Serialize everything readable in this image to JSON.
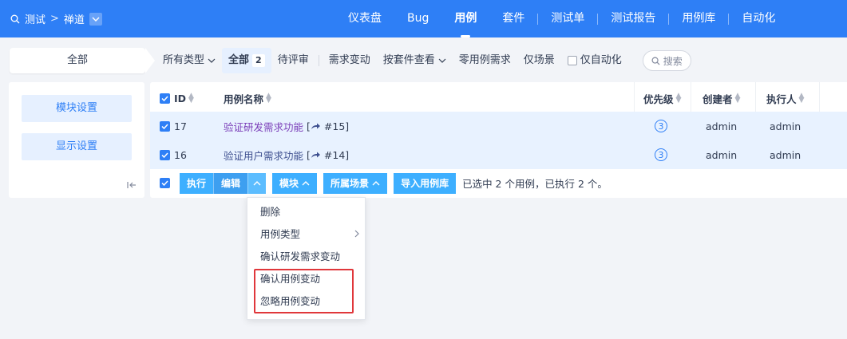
{
  "topbar": {
    "product": "测试",
    "separator": ">",
    "project": "禅道",
    "nav": [
      "仪表盘",
      "Bug",
      "用例",
      "套件",
      "测试单",
      "测试报告",
      "用例库",
      "自动化"
    ],
    "active_nav": "用例",
    "color": "#2e7ff6"
  },
  "filterbar": {
    "crumb": "全部",
    "items": {
      "all_types": "所有类型",
      "all": "全部",
      "all_count": "2",
      "pending_review": "待评审",
      "need_change": "需求变动",
      "by_suite": "按套件查看",
      "zero_case_need": "零用例需求",
      "scene_only": "仅场景",
      "auto_only": "仅自动化",
      "search": "搜索"
    }
  },
  "leftpanel": {
    "module_settings": "模块设置",
    "display_settings": "显示设置"
  },
  "table": {
    "columns": [
      "ID",
      "用例名称",
      "优先级",
      "创建者",
      "执行人"
    ],
    "rows": [
      {
        "id": "17",
        "title": "验证研发需求功能",
        "ref": "#15]",
        "priority": "3",
        "creator": "admin",
        "executor": "admin"
      },
      {
        "id": "16",
        "title": "验证用户需求功能",
        "ref": "#14]",
        "priority": "3",
        "creator": "admin",
        "executor": "admin"
      }
    ]
  },
  "actionbar": {
    "run": "执行",
    "edit": "编辑",
    "module": "模块",
    "scene": "所属场景",
    "import_lib": "导入用例库",
    "selection_info": "已选中 2 个用例，已执行 2 个。"
  },
  "dropdown": {
    "items": [
      "删除",
      "用例类型",
      "确认研发需求变动",
      "确认用例变动",
      "忽略用例变动"
    ],
    "highlight_color": "#e0373b"
  }
}
